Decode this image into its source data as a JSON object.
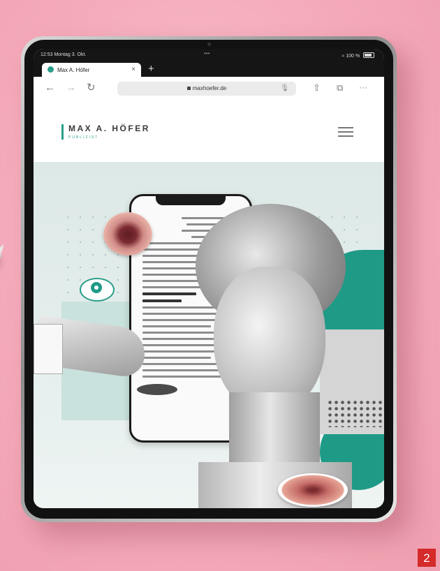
{
  "browser": {
    "status_time": "12:53  Montag 3. Okt.",
    "status_dots": "•••",
    "status_signal": "≈ 100 %",
    "tab_title": "Max A. Höfer",
    "tab_close": "×",
    "new_tab": "+",
    "back_icon": "←",
    "forward_icon": "→",
    "reload_icon": "↻",
    "url": "maxhoefer.de",
    "mic_icon": "🎙",
    "share_icon": "⇧",
    "tabs_icon": "⧉",
    "more_icon": "···"
  },
  "site": {
    "logo_name": "MAX A. HÖFER",
    "logo_sub": "PUBLIZIST"
  },
  "page_number": "2",
  "colors": {
    "accent": "#2b9e8a",
    "background": "#f5b3c1",
    "badge": "#d42a2a"
  }
}
